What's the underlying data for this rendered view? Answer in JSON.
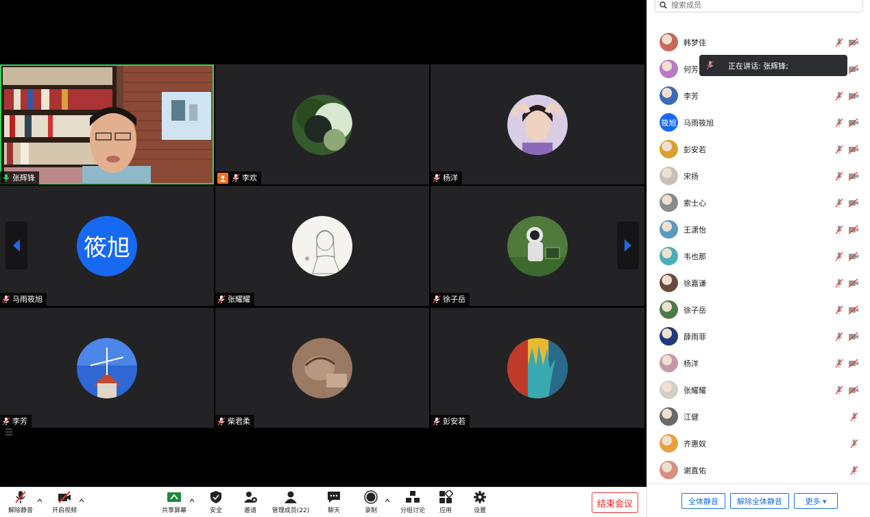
{
  "tiles": [
    {
      "name": "张辉锋",
      "mic": "on",
      "active": true
    },
    {
      "name": "李欢",
      "mic": "off",
      "host": true
    },
    {
      "name": "杨洋",
      "mic": "off"
    },
    {
      "name": "马雨筱旭",
      "mic": "off",
      "avatar_text": "筱旭"
    },
    {
      "name": "张耀耀",
      "mic": "off"
    },
    {
      "name": "徐子岳",
      "mic": "off"
    },
    {
      "name": "李芳",
      "mic": "off"
    },
    {
      "name": "柴君柔",
      "mic": "off"
    },
    {
      "name": "彭安若",
      "mic": "off"
    }
  ],
  "toolbar": {
    "unmute": "解除静音",
    "start_video": "开启视频",
    "share_screen": "共享屏幕",
    "security": "安全",
    "invite": "邀请",
    "manage_participants": "管理成员(22)",
    "chat": "聊天",
    "record": "录制",
    "breakout": "分组讨论",
    "apps": "应用",
    "settings": "设置",
    "end_meeting": "结束会议"
  },
  "panel": {
    "search_placeholder": "搜索成员",
    "tooltip": "正在讲话: 张辉锋;",
    "participants": [
      {
        "name": "韩梦佳",
        "cam": true
      },
      {
        "name": "何芳",
        "cam": true
      },
      {
        "name": "李芳",
        "cam": true
      },
      {
        "name": "马雨筱旭",
        "cam": true,
        "avatar_text": "筱旭"
      },
      {
        "name": "彭安若",
        "cam": true
      },
      {
        "name": "宋扬",
        "cam": true
      },
      {
        "name": "索士心",
        "cam": true
      },
      {
        "name": "王潇怡",
        "cam": true
      },
      {
        "name": "韦也那",
        "cam": true
      },
      {
        "name": "徐嘉谦",
        "cam": true
      },
      {
        "name": "徐子岳",
        "cam": true
      },
      {
        "name": "薛雨菲",
        "cam": true
      },
      {
        "name": "杨洋",
        "cam": true
      },
      {
        "name": "张耀耀",
        "cam": true
      },
      {
        "name": "江健",
        "cam": false
      },
      {
        "name": "齐惠奴",
        "cam": false
      },
      {
        "name": "谢直佑",
        "cam": false
      }
    ],
    "footer": {
      "mute_all": "全体静音",
      "unmute_all": "解除全体静音",
      "more": "更多 ▾"
    }
  },
  "colors": {
    "accent_blue": "#1769f2",
    "end_red": "#e22222",
    "active_green": "#39d15b"
  }
}
